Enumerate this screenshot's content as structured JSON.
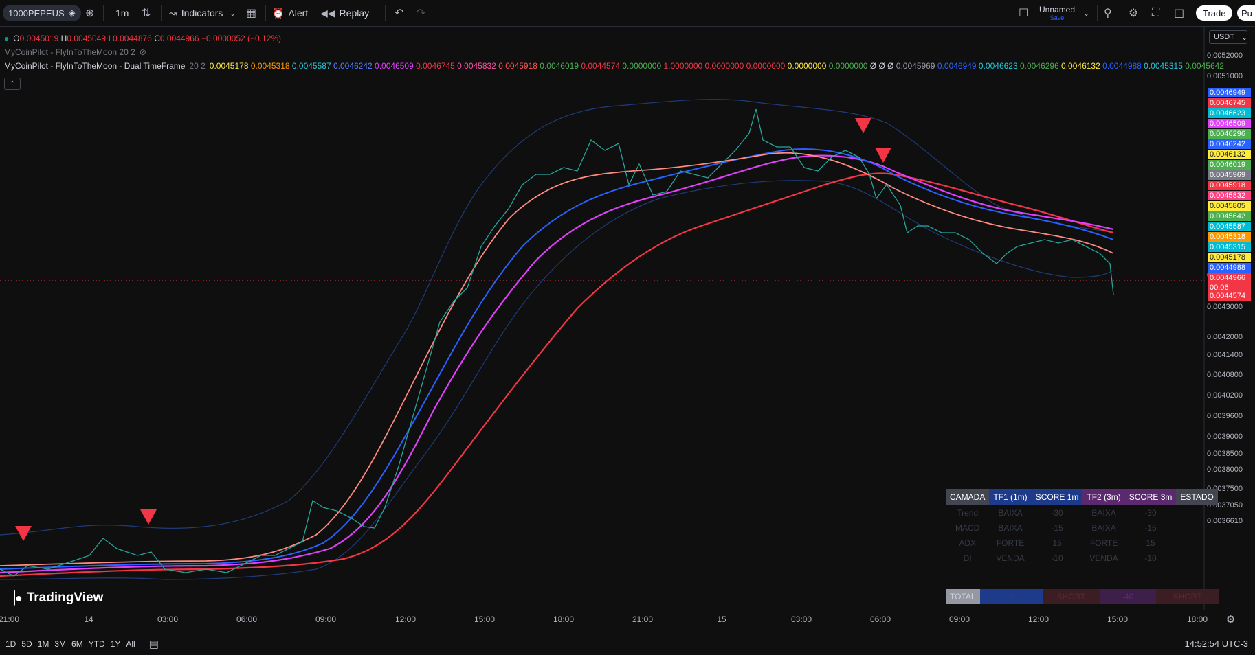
{
  "toolbar": {
    "symbol": "1000PEPEUS",
    "interval": "1m",
    "indicators_label": "Indicators",
    "alert_label": "Alert",
    "replay_label": "Replay",
    "layout_name": "Unnamed",
    "layout_status": "Save",
    "trade_label": "Trade",
    "publish_label": "Pu"
  },
  "legend": {
    "ohlc": {
      "o_label": "O",
      "o": "0.0045019",
      "h_label": "H",
      "h": "0.0045049",
      "l_label": "L",
      "l": "0.0044876",
      "c_label": "C",
      "c": "0.0044966",
      "change": "−0.0000052 (−0.12%)"
    },
    "indicator1": "MyCoinPilot - FlyInToTheMoon 20 2",
    "indicator2_name": "MyCoinPilot - FlyInToTheMoon - Dual TimeFrame",
    "indicator2_params": "20 2",
    "indicator2_values": [
      {
        "v": "0.0045178",
        "color": "#f7e84a"
      },
      {
        "v": "0.0045318",
        "color": "#ff9800"
      },
      {
        "v": "0.0045587",
        "color": "#26c6da"
      },
      {
        "v": "0.0046242",
        "color": "#5b7cff"
      },
      {
        "v": "0.0046509",
        "color": "#e040fb"
      },
      {
        "v": "0.0046745",
        "color": "#f23645"
      },
      {
        "v": "0.0045832",
        "color": "#ff4fa3"
      },
      {
        "v": "0.0045918",
        "color": "#ff5252"
      },
      {
        "v": "0.0046019",
        "color": "#4caf50"
      },
      {
        "v": "0.0044574",
        "color": "#f23645"
      },
      {
        "v": "0.0000000",
        "color": "#4caf50"
      },
      {
        "v": "1.0000000",
        "color": "#f23645"
      },
      {
        "v": "0.0000000",
        "color": "#f23645"
      },
      {
        "v": "0.0000000",
        "color": "#f23645"
      },
      {
        "v": "0.0000000",
        "color": "#ffeb3b"
      },
      {
        "v": "0.0000000",
        "color": "#4caf50"
      },
      {
        "v": "Ø Ø Ø",
        "color": "#d1d4dc"
      },
      {
        "v": "0.0045969",
        "color": "#9598a1"
      },
      {
        "v": "0.0046949",
        "color": "#2962ff"
      },
      {
        "v": "0.0046623",
        "color": "#26c6da"
      },
      {
        "v": "0.0046296",
        "color": "#4caf50"
      },
      {
        "v": "0.0046132",
        "color": "#ffeb3b"
      },
      {
        "v": "0.0044988",
        "color": "#2962ff"
      },
      {
        "v": "0.0045315",
        "color": "#26c6da"
      },
      {
        "v": "0.0045642",
        "color": "#4caf50"
      }
    ]
  },
  "price_scale": {
    "currency": "USDT",
    "levels": [
      "0.0052000",
      "0.0051000",
      "0.0044000",
      "0.0043000",
      "0.0042000",
      "0.0041400",
      "0.0040800",
      "0.0040200",
      "0.0039600",
      "0.0039000",
      "0.0038500",
      "0.0038000",
      "0.0037500",
      "0.0037050",
      "0.0036610"
    ],
    "tags": [
      {
        "v": "0.0046949",
        "color": "#2962ff"
      },
      {
        "v": "0.0046745",
        "color": "#f23645"
      },
      {
        "v": "0.0046623",
        "color": "#00bcd4"
      },
      {
        "v": "0.0046509",
        "color": "#e040fb"
      },
      {
        "v": "0.0046296",
        "color": "#4caf50"
      },
      {
        "v": "0.0046242",
        "color": "#2962ff"
      },
      {
        "v": "0.0046132",
        "color": "#ffeb3b",
        "text": "#131722"
      },
      {
        "v": "0.0046019",
        "color": "#4caf50"
      },
      {
        "v": "0.0045969",
        "color": "#787b86"
      },
      {
        "v": "0.0045918",
        "color": "#f23645"
      },
      {
        "v": "0.0045832",
        "color": "#ff4081"
      },
      {
        "v": "0.0045805",
        "color": "#ffeb3b",
        "text": "#131722"
      },
      {
        "v": "0.0045642",
        "color": "#4caf50"
      },
      {
        "v": "0.0045587",
        "color": "#00bcd4"
      },
      {
        "v": "0.0045318",
        "color": "#ff9800"
      },
      {
        "v": "0.0045315",
        "color": "#00bcd4"
      },
      {
        "v": "0.0045178",
        "color": "#ffeb3b",
        "text": "#131722"
      },
      {
        "v": "0.0044988",
        "color": "#2962ff"
      },
      {
        "v": "0.0044966",
        "color": "#f23645",
        "sub": "00:06"
      },
      {
        "v": "0.0044574",
        "color": "#f23645"
      }
    ]
  },
  "time_axis": [
    "21:00",
    "14",
    "03:00",
    "06:00",
    "09:00",
    "12:00",
    "15:00",
    "18:00",
    "21:00",
    "15",
    "03:00",
    "06:00",
    "09:00",
    "12:00",
    "15:00",
    "18:00"
  ],
  "score_table": {
    "headers": [
      {
        "label": "CAMADA",
        "bg": "#434651"
      },
      {
        "label": "TF1 (1m)",
        "bg": "#1e3a8a"
      },
      {
        "label": "SCORE 1m",
        "bg": "#1e3a8a"
      },
      {
        "label": "TF2 (3m)",
        "bg": "#5b2a6e"
      },
      {
        "label": "SCORE 3m",
        "bg": "#5b2a6e"
      },
      {
        "label": "ESTADO",
        "bg": "#434651"
      }
    ],
    "rows": [
      [
        "Trend",
        "BAIXA",
        "-30",
        "BAIXA",
        "-30",
        ""
      ],
      [
        "MACD",
        "BAIXA",
        "-15",
        "BAIXA",
        "-15",
        ""
      ],
      [
        "ADX",
        "FORTE",
        "15",
        "FORTE",
        "15",
        ""
      ],
      [
        "DI",
        "VENDA",
        "-10",
        "VENDA",
        "-10",
        ""
      ]
    ],
    "total": {
      "label": "TOTAL",
      "score1": "-40",
      "state1": "SHORT",
      "score2": "-40",
      "state2": "SHORT"
    }
  },
  "bottom": {
    "ranges": [
      "1D",
      "5D",
      "1M",
      "3M",
      "6M",
      "YTD",
      "1Y",
      "All"
    ],
    "clock": "14:52:54 UTC-3"
  },
  "branding": "TradingView",
  "colors": {
    "background": "#0f0f0f",
    "up": "#089981",
    "down": "#f23645"
  }
}
